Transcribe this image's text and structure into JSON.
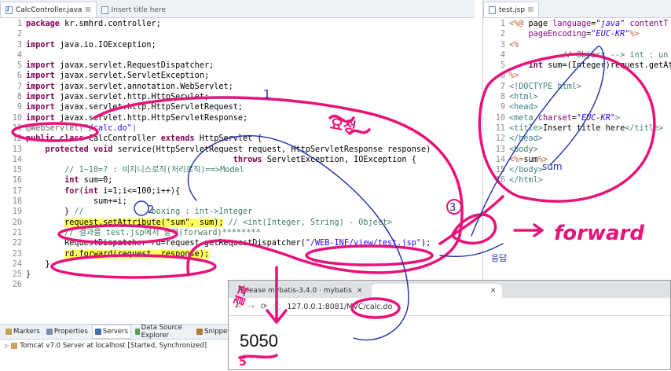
{
  "left_tabs": [
    {
      "label": "CalcController.java",
      "close": "☒"
    },
    {
      "label": "Insert title here"
    }
  ],
  "left_lines": [
    {
      "n": "1",
      "segs": [
        {
          "k": "kw",
          "t": "package"
        },
        {
          "k": "txt",
          "t": " kr.smhrd.controller;"
        }
      ]
    },
    {
      "n": "2",
      "segs": []
    },
    {
      "n": "3",
      "segs": [
        {
          "k": "kw",
          "t": "import"
        },
        {
          "k": "txt",
          "t": " java.io.IOException;"
        }
      ]
    },
    {
      "n": "4",
      "segs": []
    },
    {
      "n": "5",
      "segs": [
        {
          "k": "kw",
          "t": "import"
        },
        {
          "k": "txt",
          "t": " javax.servlet.RequestDispatcher;"
        }
      ]
    },
    {
      "n": "6",
      "segs": [
        {
          "k": "kw",
          "t": "import"
        },
        {
          "k": "txt",
          "t": " javax.servlet.ServletException;"
        }
      ]
    },
    {
      "n": "7",
      "segs": [
        {
          "k": "kw",
          "t": "import"
        },
        {
          "k": "txt",
          "t": " javax.servlet.annotation.WebServlet;"
        }
      ]
    },
    {
      "n": "8",
      "segs": [
        {
          "k": "kw",
          "t": "import"
        },
        {
          "k": "txt",
          "t": " javax.servlet.http.HttpServlet;"
        }
      ]
    },
    {
      "n": "9",
      "segs": [
        {
          "k": "kw",
          "t": "import"
        },
        {
          "k": "txt",
          "t": " javax.servlet.http.HttpServletRequest;"
        }
      ]
    },
    {
      "n": "10",
      "segs": [
        {
          "k": "kw",
          "t": "import"
        },
        {
          "k": "txt",
          "t": " javax.servlet.http.HttpServletResponse;"
        }
      ]
    },
    {
      "n": "11",
      "segs": [
        {
          "k": "ann",
          "t": "@WebServlet("
        },
        {
          "k": "str",
          "t": "\"/calc.do\""
        },
        {
          "k": "ann",
          "t": ")"
        }
      ]
    },
    {
      "n": "12",
      "segs": [
        {
          "k": "kw",
          "t": "public class"
        },
        {
          "k": "txt",
          "t": " CalcController "
        },
        {
          "k": "kw",
          "t": "extends"
        },
        {
          "k": "txt",
          "t": " HttpServlet {"
        }
      ]
    },
    {
      "n": "13",
      "segs": [
        {
          "k": "txt",
          "t": "    "
        },
        {
          "k": "kw",
          "t": "protected void"
        },
        {
          "k": "txt",
          "t": " service(HttpServletRequest request, HttpServletResponse response)"
        }
      ]
    },
    {
      "n": "14",
      "segs": [
        {
          "k": "txt",
          "t": "                                           "
        },
        {
          "k": "kw",
          "t": "throws"
        },
        {
          "k": "txt",
          "t": " ServletException, IOException {"
        }
      ]
    },
    {
      "n": "15",
      "segs": [
        {
          "k": "txt",
          "t": "        "
        },
        {
          "k": "cmt",
          "t": "// 1~10=? : 비지니스로직(처리로직)==>Model"
        }
      ]
    },
    {
      "n": "16",
      "segs": [
        {
          "k": "txt",
          "t": "        "
        },
        {
          "k": "kw",
          "t": "int"
        },
        {
          "k": "txt",
          "t": " sum=0;"
        }
      ]
    },
    {
      "n": "17",
      "segs": [
        {
          "k": "txt",
          "t": "        "
        },
        {
          "k": "kw",
          "t": "for"
        },
        {
          "k": "txt",
          "t": "("
        },
        {
          "k": "kw",
          "t": "int"
        },
        {
          "k": "txt",
          "t": " i=1;i<=100;i++){"
        }
      ]
    },
    {
      "n": "18",
      "segs": [
        {
          "k": "txt",
          "t": "              sum+=i;"
        }
      ]
    },
    {
      "n": "19",
      "segs": [
        {
          "k": "txt",
          "t": "        } "
        },
        {
          "k": "cmt",
          "t": "//              boxing : int->Integer"
        }
      ]
    },
    {
      "n": "20",
      "segs": [
        {
          "k": "txt",
          "t": "        "
        },
        {
          "k": "hl",
          "t": "request.setAttribute(\"sum\", sum);"
        },
        {
          "k": "cmt",
          "t": " // <int(Integer, String) - Object>"
        }
      ]
    },
    {
      "n": "21",
      "segs": [
        {
          "k": "txt",
          "t": "        "
        },
        {
          "k": "cmt",
          "t": "// 결과를 test.jsp에서 출력(forward)********"
        }
      ]
    },
    {
      "n": "22",
      "segs": [
        {
          "k": "txt",
          "t": "        RequestDispatcher rd=request.getRequestDispatcher("
        },
        {
          "k": "str",
          "t": "\"/WEB-INF/view/test.jsp\""
        },
        {
          "k": "txt",
          "t": ");"
        }
      ]
    },
    {
      "n": "23",
      "segs": [
        {
          "k": "txt",
          "t": "        "
        },
        {
          "k": "hl",
          "t": "rd.forward(request, response);"
        }
      ]
    },
    {
      "n": "24",
      "segs": [
        {
          "k": "txt",
          "t": "    }"
        }
      ]
    },
    {
      "n": "25",
      "segs": [
        {
          "k": "txt",
          "t": "}"
        }
      ]
    },
    {
      "n": "26",
      "segs": []
    }
  ],
  "right_tab": {
    "label": "test.jsp",
    "close": "☒"
  },
  "right_lines": [
    {
      "n": "1",
      "segs": [
        {
          "k": "jsp",
          "t": "<%@"
        },
        {
          "k": "txt",
          "t": " page "
        },
        {
          "k": "at",
          "t": "language"
        },
        {
          "k": "txt",
          "t": "="
        },
        {
          "k": "av",
          "t": "\"java\""
        },
        {
          "k": "txt",
          "t": " "
        },
        {
          "k": "at",
          "t": "contentT"
        }
      ]
    },
    {
      "n": "2",
      "segs": [
        {
          "k": "txt",
          "t": "    "
        },
        {
          "k": "at",
          "t": "pageEncoding"
        },
        {
          "k": "txt",
          "t": "="
        },
        {
          "k": "av",
          "t": "\"EUC-KR\""
        },
        {
          "k": "jsp",
          "t": "%>"
        }
      ]
    },
    {
      "n": "3",
      "segs": [
        {
          "k": "jsp",
          "t": "<%"
        }
      ]
    },
    {
      "n": "4",
      "segs": [
        {
          "k": "txt",
          "t": "           "
        },
        {
          "k": "cmt",
          "t": "// Object --> int : un"
        }
      ]
    },
    {
      "n": "5",
      "segs": [
        {
          "k": "txt",
          "t": "    "
        },
        {
          "k": "kw",
          "t": "int"
        },
        {
          "k": "txt",
          "t": " sum=(Integer)request.getAt"
        }
      ]
    },
    {
      "n": "6",
      "segs": [
        {
          "k": "jsp",
          "t": "%>"
        }
      ]
    },
    {
      "n": "7",
      "segs": [
        {
          "k": "tg",
          "t": "<!DOCTYPE html>"
        }
      ]
    },
    {
      "n": "8",
      "segs": [
        {
          "k": "tg",
          "t": "<html>"
        }
      ]
    },
    {
      "n": "9",
      "segs": [
        {
          "k": "tg",
          "t": "<head>"
        }
      ]
    },
    {
      "n": "10",
      "segs": [
        {
          "k": "tg",
          "t": "<meta "
        },
        {
          "k": "at",
          "t": "charset"
        },
        {
          "k": "txt",
          "t": "="
        },
        {
          "k": "av",
          "t": "\"EUC-KR\""
        },
        {
          "k": "tg",
          "t": ">"
        }
      ]
    },
    {
      "n": "11",
      "segs": [
        {
          "k": "tg",
          "t": "<title>"
        },
        {
          "k": "txt",
          "t": "Insert title here"
        },
        {
          "k": "tg",
          "t": "</title>"
        }
      ]
    },
    {
      "n": "12",
      "segs": [
        {
          "k": "tg",
          "t": "</head>"
        }
      ]
    },
    {
      "n": "13",
      "segs": [
        {
          "k": "tg",
          "t": "<body>"
        }
      ]
    },
    {
      "n": "14",
      "segs": [
        {
          "k": "jsp",
          "t": "<%="
        },
        {
          "k": "txt",
          "t": "sum"
        },
        {
          "k": "jsp",
          "t": "%>"
        }
      ]
    },
    {
      "n": "15",
      "segs": [
        {
          "k": "tg",
          "t": "</body>"
        }
      ]
    },
    {
      "n": "16",
      "segs": [
        {
          "k": "tg",
          "t": "</html>"
        }
      ]
    }
  ],
  "bottom_tabs": [
    "Markers",
    "Properties",
    "Servers",
    "Data Source Explorer",
    "Snippets"
  ],
  "server_row": "Tomcat v7.0 Server at localhost  [Started, Synchronized]",
  "browser": {
    "tab1": "Release mybatis-3.4.0 · mybatis",
    "url": "127.0.0.1:8081/MVC/calc.do",
    "result": "5050"
  },
  "handwriting": {
    "forward": "forward",
    "num1": "1",
    "num2": "2",
    "num3": "3",
    "note_top": "요청",
    "note_resp": "응답",
    "note_result": "결과",
    "note_down": "응답",
    "note_sum": "sum",
    "under_result": "5"
  },
  "colors": {
    "ink": "#e8127a",
    "ink2": "#1c2fa8"
  }
}
